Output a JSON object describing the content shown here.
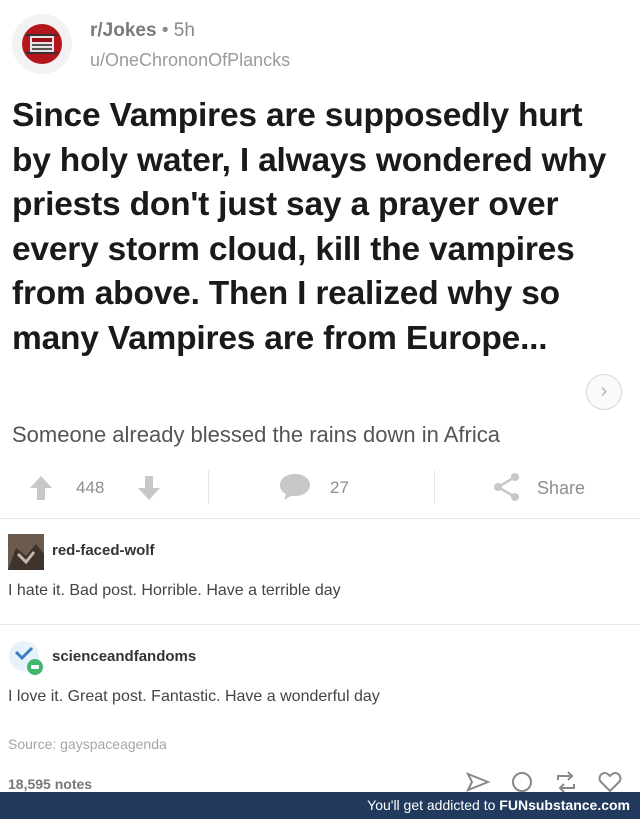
{
  "post": {
    "subreddit": "r/Jokes",
    "time": "• 5h",
    "username": "u/OneChrononOfPlancks",
    "title": "Since Vampires are supposedly hurt by holy water, I always wondered why priests don't just say a prayer over every storm cloud, kill the vampires from above. Then I realized why so many Vampires are from Europe...",
    "body": "Someone already blessed the rains down in Africa",
    "expand_icon": "chevron-right-icon"
  },
  "actions": {
    "upvotes": "448",
    "comments": "27",
    "share_label": "Share"
  },
  "replies": [
    {
      "name": "red-faced-wolf",
      "text": "I hate it. Bad post. Horrible. Have a terrible day"
    },
    {
      "name": "scienceandfandoms",
      "text": "I love it. Great post. Fantastic. Have a wonderful day"
    }
  ],
  "source": "Source:  gayspaceagenda",
  "notes": "18,595 notes",
  "footer": {
    "prefix": "You'll get addicted to ",
    "brand": "FUNsubstance.com"
  },
  "colors": {
    "footer_bg": "#213a5e",
    "subreddit_avatar": "#b3161c"
  }
}
